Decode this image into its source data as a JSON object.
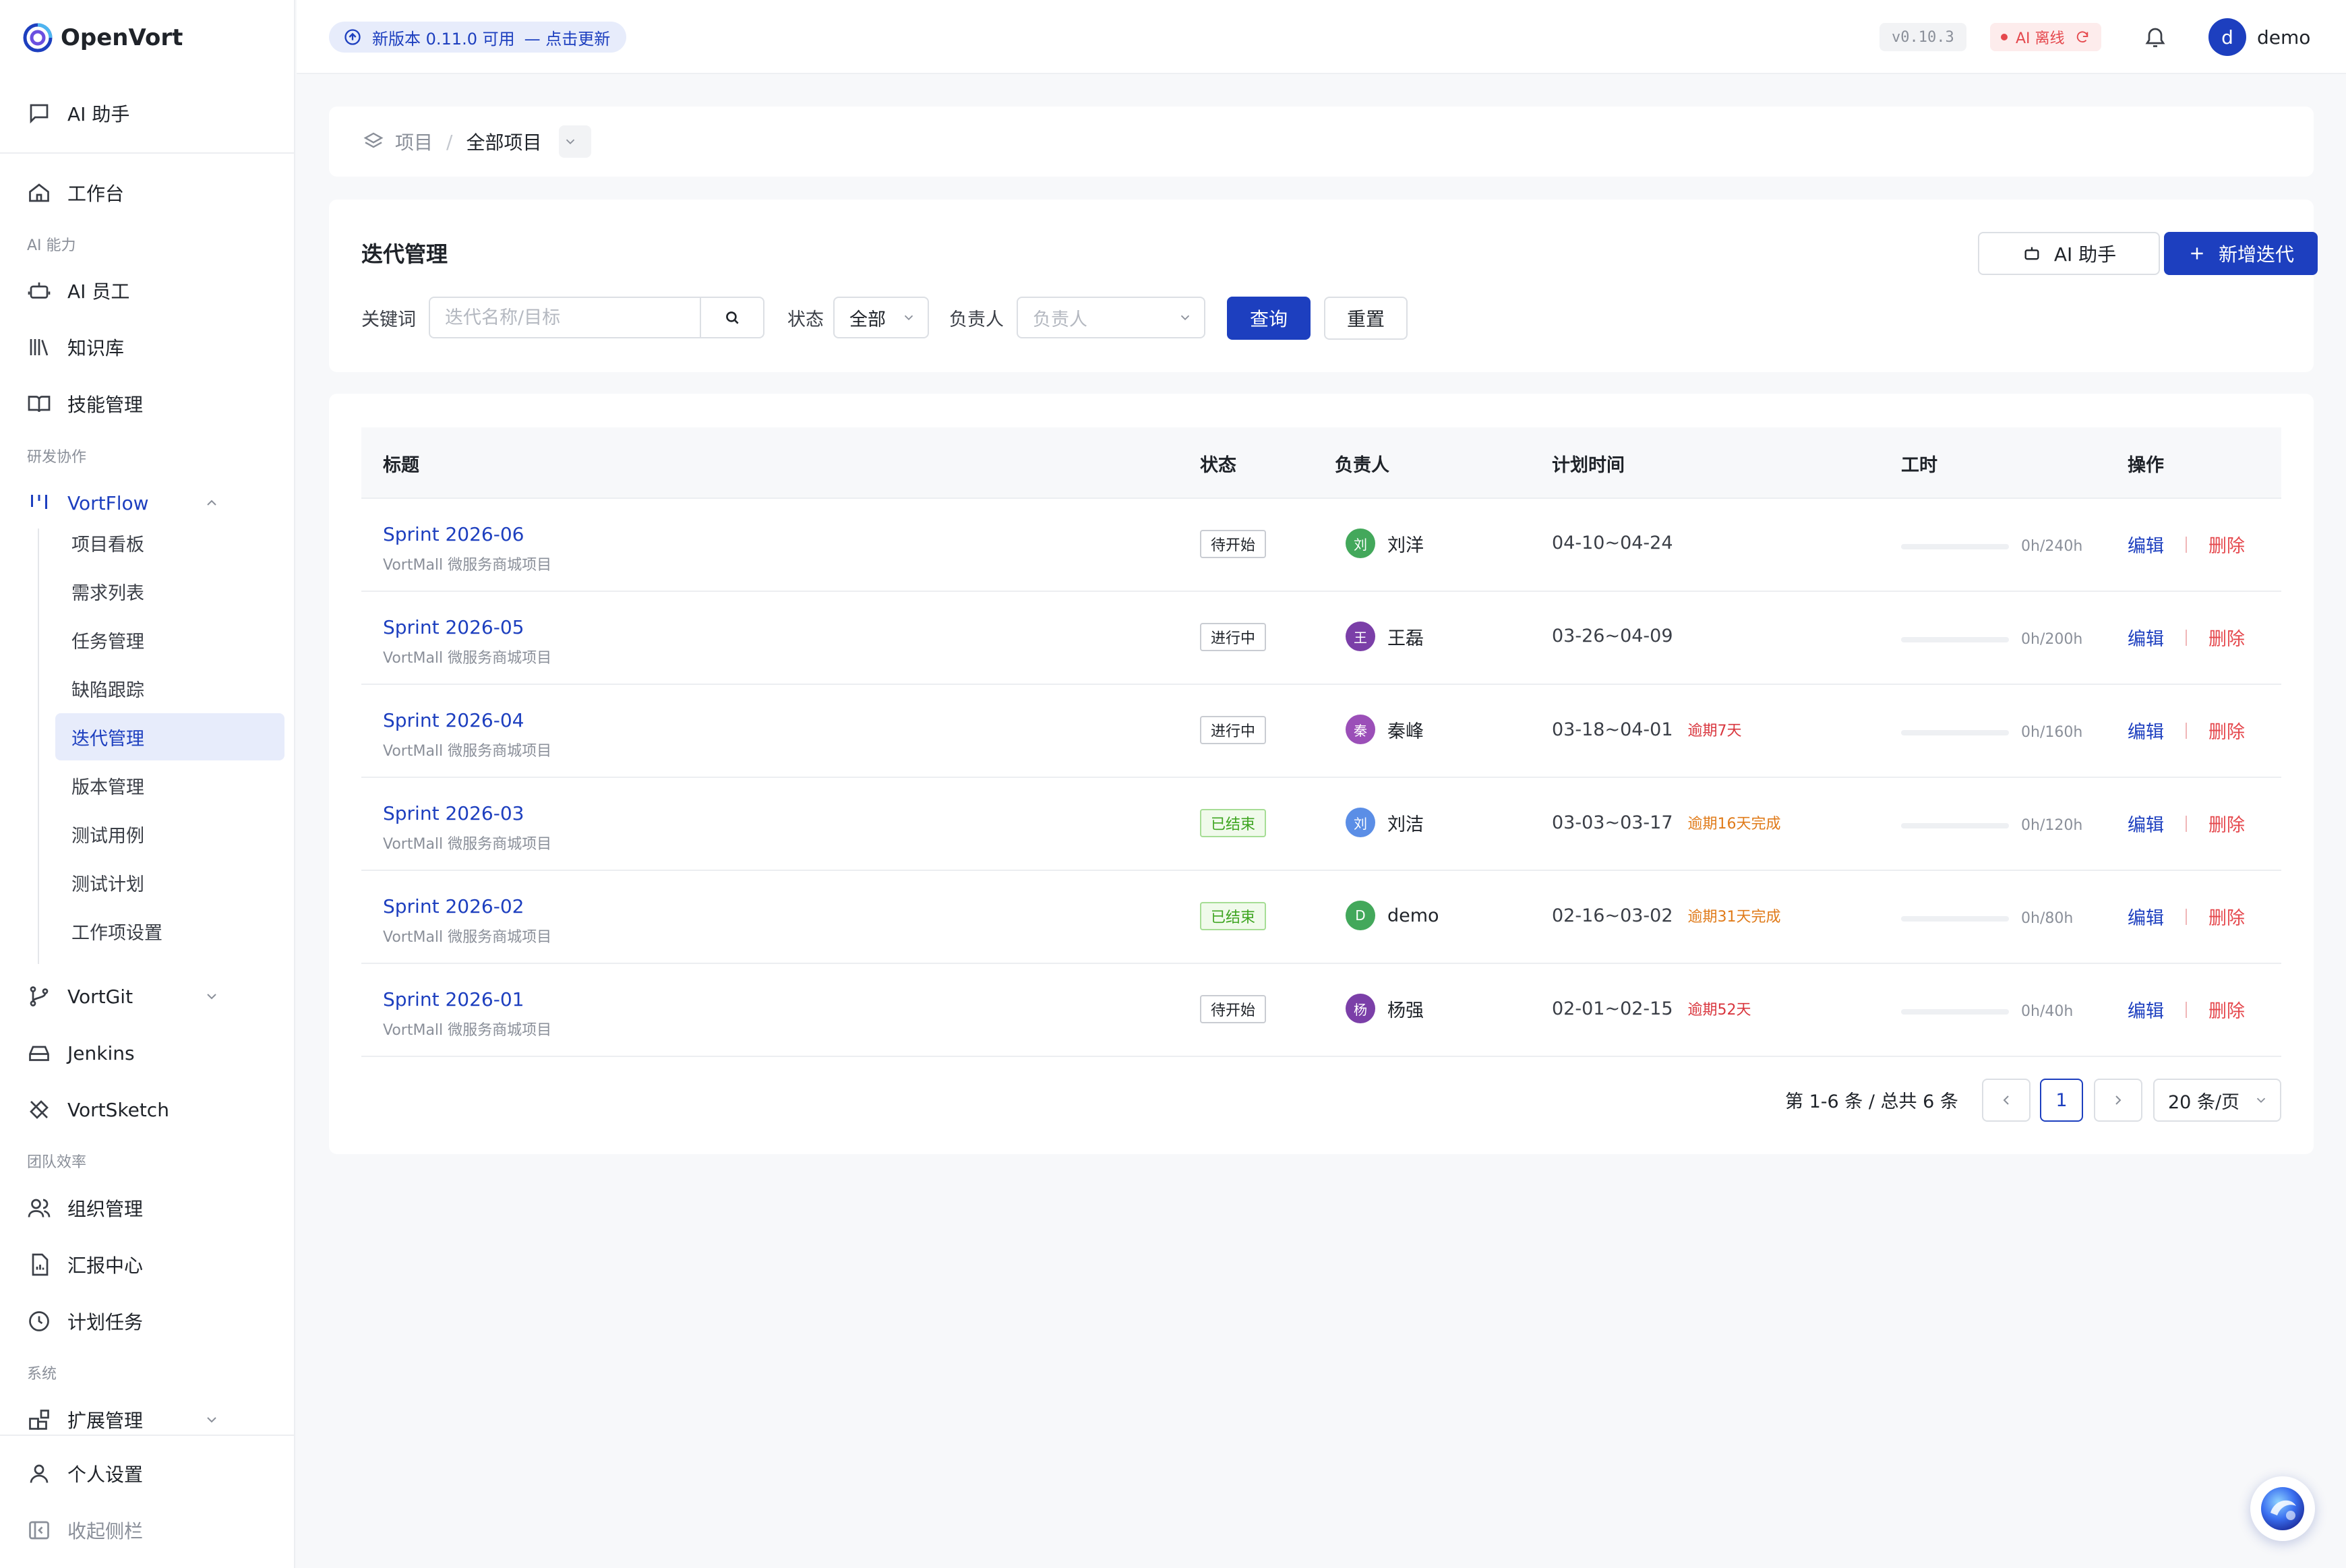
{
  "app": {
    "name": "OpenVort",
    "brand_color": "#1d3fbf"
  },
  "sidebar": {
    "ai_assistant": "AI 助手",
    "workbench": "工作台",
    "sec_ai": "AI 能力",
    "ai_staff": "AI 员工",
    "knowledge": "知识库",
    "skills": "技能管理",
    "sec_dev": "研发协作",
    "vortflow": "VortFlow",
    "vortflow_sub": [
      "项目看板",
      "需求列表",
      "任务管理",
      "缺陷跟踪",
      "迭代管理",
      "版本管理",
      "测试用例",
      "测试计划",
      "工作项设置"
    ],
    "vortgit": "VortGit",
    "jenkins": "Jenkins",
    "vortsketch": "VortSketch",
    "sec_team": "团队效率",
    "org": "组织管理",
    "report": "汇报中心",
    "plan_tasks": "计划任务",
    "sec_sys": "系统",
    "extensions": "扩展管理",
    "personal": "个人设置",
    "collapse": "收起侧栏"
  },
  "header": {
    "update_text": "新版本 0.11.0 可用",
    "update_link": "— 点击更新",
    "version": "v0.10.3",
    "ai_status": "AI 离线",
    "user_initial": "d",
    "user_name": "demo"
  },
  "breadcrumb": {
    "root": "项目",
    "sep": "/",
    "current": "全部项目"
  },
  "page": {
    "title": "迭代管理",
    "ai_button": "AI 助手",
    "add_button": "新增迭代",
    "filters": {
      "keyword_label": "关键词",
      "keyword_placeholder": "迭代名称/目标",
      "status_label": "状态",
      "status_value": "全部",
      "owner_label": "负责人",
      "owner_placeholder": "负责人",
      "query": "查询",
      "reset": "重置"
    }
  },
  "table": {
    "headers": {
      "title": "标题",
      "status": "状态",
      "owner": "负责人",
      "plan": "计划时间",
      "hours": "工时",
      "ops": "操作"
    },
    "rows": [
      {
        "title": "Sprint 2026-06",
        "project": "VortMall 微服务商城项目",
        "status": "待开始",
        "status_type": "pending",
        "owner_initial": "刘",
        "owner": "刘洋",
        "owner_color": "#43a85b",
        "plan": "04-10~04-24",
        "tag": "",
        "tag_type": "",
        "hours": "0h/240h",
        "progress": 0,
        "edit": "编辑",
        "del": "删除"
      },
      {
        "title": "Sprint 2026-05",
        "project": "VortMall 微服务商城项目",
        "status": "进行中",
        "status_type": "pending",
        "owner_initial": "王",
        "owner": "王磊",
        "owner_color": "#7b3fa8",
        "plan": "03-26~04-09",
        "tag": "",
        "tag_type": "",
        "hours": "0h/200h",
        "progress": 0,
        "edit": "编辑",
        "del": "删除"
      },
      {
        "title": "Sprint 2026-04",
        "project": "VortMall 微服务商城项目",
        "status": "进行中",
        "status_type": "pending",
        "owner_initial": "秦",
        "owner": "秦峰",
        "owner_color": "#9b4fb8",
        "plan": "03-18~04-01",
        "tag": "逾期7天",
        "tag_type": "over",
        "hours": "0h/160h",
        "progress": 0,
        "edit": "编辑",
        "del": "删除"
      },
      {
        "title": "Sprint 2026-03",
        "project": "VortMall 微服务商城项目",
        "status": "已结束",
        "status_type": "done",
        "owner_initial": "刘",
        "owner": "刘洁",
        "owner_color": "#5b8ee6",
        "plan": "03-03~03-17",
        "tag": "逾期16天完成",
        "tag_type": "late",
        "hours": "0h/120h",
        "progress": 0,
        "edit": "编辑",
        "del": "删除"
      },
      {
        "title": "Sprint 2026-02",
        "project": "VortMall 微服务商城项目",
        "status": "已结束",
        "status_type": "done",
        "owner_initial": "D",
        "owner": "demo",
        "owner_color": "#43a85b",
        "plan": "02-16~03-02",
        "tag": "逾期31天完成",
        "tag_type": "late",
        "hours": "0h/80h",
        "progress": 0,
        "edit": "编辑",
        "del": "删除"
      },
      {
        "title": "Sprint 2026-01",
        "project": "VortMall 微服务商城项目",
        "status": "待开始",
        "status_type": "pending",
        "owner_initial": "杨",
        "owner": "杨强",
        "owner_color": "#7b3fa8",
        "plan": "02-01~02-15",
        "tag": "逾期52天",
        "tag_type": "over",
        "hours": "0h/40h",
        "progress": 0,
        "edit": "编辑",
        "del": "删除"
      }
    ]
  },
  "pagination": {
    "total_text": "第 1-6 条 / 总共 6 条",
    "current_page": "1",
    "page_size": "20 条/页"
  }
}
